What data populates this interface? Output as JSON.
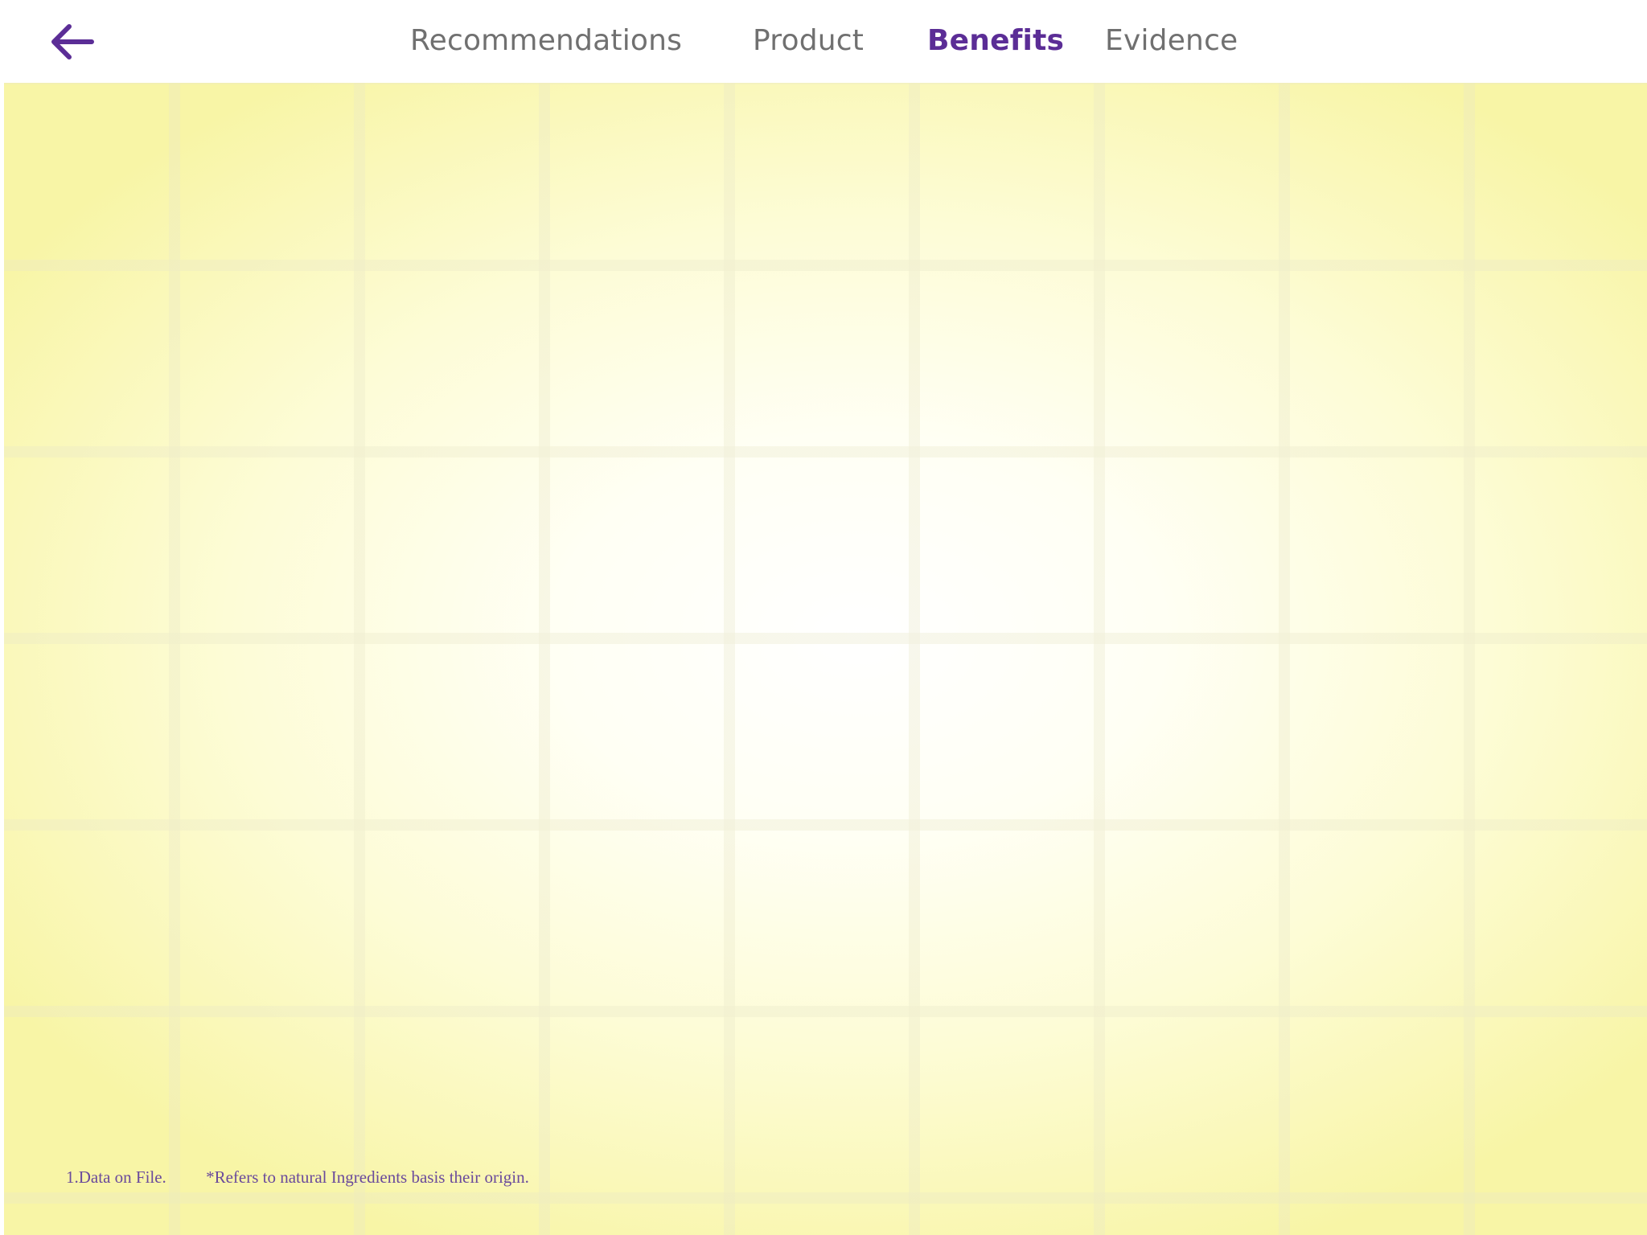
{
  "nav": {
    "back_icon": "arrow-left-icon",
    "tabs": [
      {
        "label": "Recommendations",
        "active": false
      },
      {
        "label": "Product",
        "active": false
      },
      {
        "label": "Benefits",
        "active": true
      },
      {
        "label": "Evidence",
        "active": false
      }
    ]
  },
  "footnotes": {
    "note_1": "1.Data on File.",
    "note_2": "*Refers to natural Ingredients basis their origin."
  },
  "colors": {
    "accent": "#5b2d96",
    "tab_inactive": "#707070",
    "background_center": "#ffffff",
    "background_edge": "#f8f5a6",
    "footnote": "#6a4a9c"
  }
}
